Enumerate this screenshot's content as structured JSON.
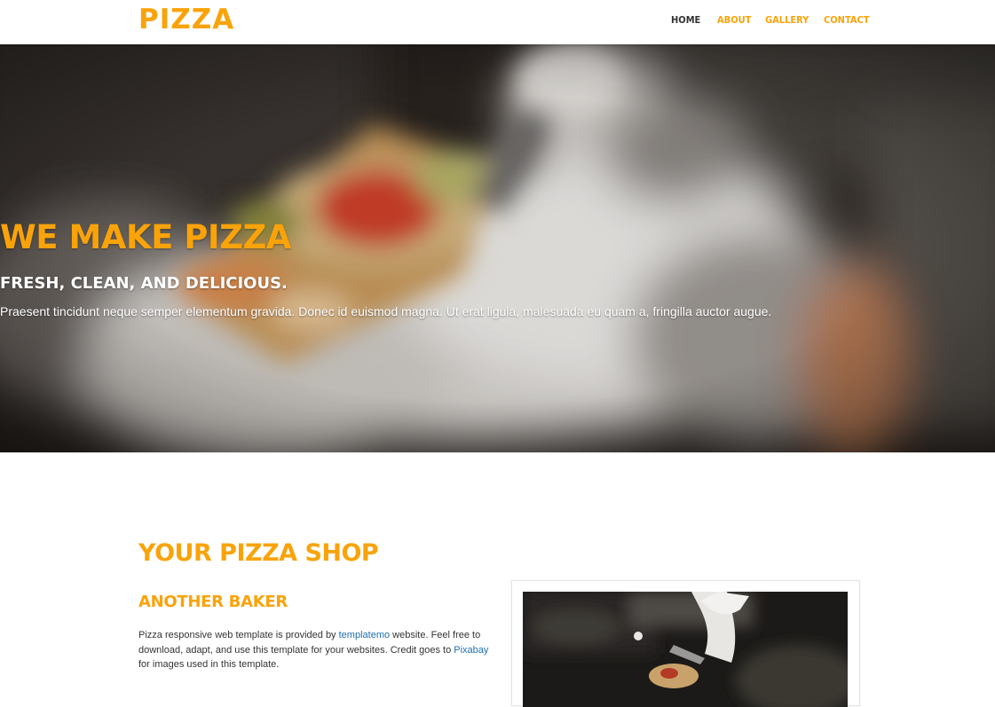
{
  "header": {
    "logo": "PIZZA",
    "nav": [
      {
        "label": "HOME",
        "active": true
      },
      {
        "label": "ABOUT",
        "active": false
      },
      {
        "label": "GALLERY",
        "active": false
      },
      {
        "label": "CONTACT",
        "active": false
      }
    ]
  },
  "hero": {
    "title": "WE MAKE PIZZA",
    "subtitle": "FRESH, CLEAN, AND DELICIOUS.",
    "description": "Praesent tincidunt neque semper elementum gravida. Donec id euismod magna. Ut erat ligula, malesuada eu quam a, fringilla auctor augue."
  },
  "about": {
    "title": "YOUR PIZZA SHOP",
    "subtitle": "ANOTHER BAKER",
    "body_part1": "Pizza responsive web template is provided by ",
    "link1": "templatemo",
    "body_part2": " website. Feel free to download, adapt, and use this template for your websites. Credit goes to ",
    "link2": "Pixabay",
    "body_part3": " for images used in this template."
  },
  "colors": {
    "accent": "#f9a30a",
    "nav_active": "#333333",
    "link": "#1f6fb2",
    "text": "#333333"
  }
}
